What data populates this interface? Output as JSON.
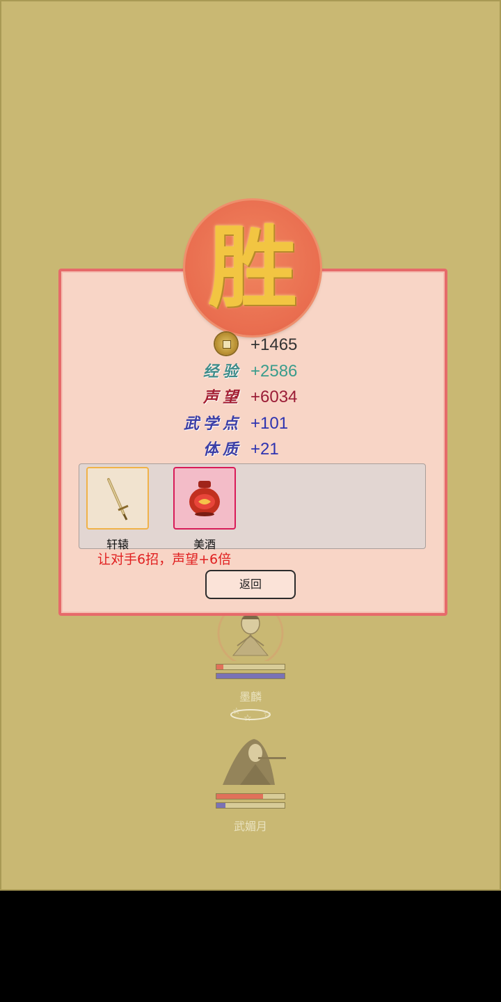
{
  "result": {
    "seal_text": "胜"
  },
  "rewards": [
    {
      "key": "coin",
      "label": "",
      "value": "+1465",
      "label_color": "#3a2a10",
      "value_color": "#333333"
    },
    {
      "key": "exp",
      "label": "经验",
      "value": "+2586",
      "label_color": "#3f8c8a",
      "value_color": "#3a9c8c"
    },
    {
      "key": "fame",
      "label": "声望",
      "value": "+6034",
      "label_color": "#a31e32",
      "value_color": "#9a1c36"
    },
    {
      "key": "martial",
      "label": "武学点",
      "value": "+101",
      "label_color": "#3b3ea6",
      "value_color": "#2d33b0"
    },
    {
      "key": "constitution",
      "label": "体质",
      "value": "+21",
      "label_color": "#3b3ea6",
      "value_color": "#2d33b0"
    }
  ],
  "items": [
    {
      "name": "轩辕",
      "icon": "sword-icon",
      "border": "#f0b248",
      "bg": "#f1e3cf"
    },
    {
      "name": "美酒",
      "icon": "wine-jar-icon",
      "border": "#d81b58",
      "bg": "#f3bcc8"
    }
  ],
  "effect_text": "让对手6招，声望+6倍",
  "back_label": "返回",
  "characters": [
    {
      "name": "墨麟",
      "hp": 0.1,
      "mp": 1.0
    },
    {
      "name": "武媚月",
      "hp": 0.68,
      "mp": 0.13
    }
  ],
  "colors": {
    "hp": "#e0715a",
    "mp": "#7a72b5",
    "dialog_border": "#e66a6a"
  }
}
